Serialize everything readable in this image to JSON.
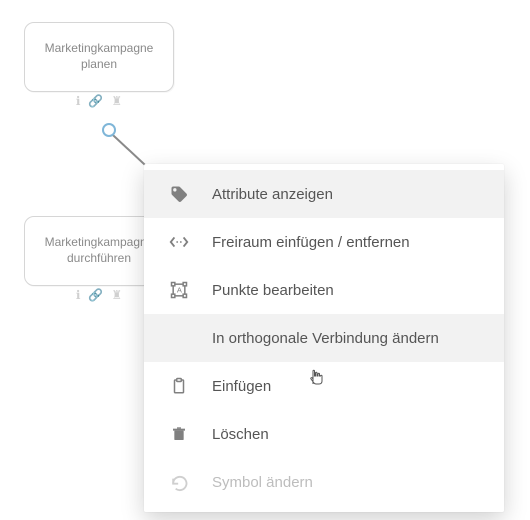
{
  "nodes": {
    "plan": {
      "label": "Marketingkampagne planen"
    },
    "exec": {
      "label": "Marketingkampagne durchführen"
    }
  },
  "menu": {
    "items": [
      {
        "id": "show-attributes",
        "label": "Attribute anzeigen",
        "icon": "tag",
        "disabled": false,
        "hover": true
      },
      {
        "id": "insert-remove-space",
        "label": "Freiraum einfügen / entfernen",
        "icon": "spacer",
        "disabled": false,
        "hover": false
      },
      {
        "id": "edit-points",
        "label": "Punkte bearbeiten",
        "icon": "transform",
        "disabled": false,
        "hover": false
      },
      {
        "id": "to-orthogonal",
        "label": "In orthogonale Verbindung ändern",
        "icon": "",
        "disabled": false,
        "hover": true
      },
      {
        "id": "paste",
        "label": "Einfügen",
        "icon": "clipboard",
        "disabled": false,
        "hover": false
      },
      {
        "id": "delete",
        "label": "Löschen",
        "icon": "trash",
        "disabled": false,
        "hover": false
      },
      {
        "id": "change-symbol",
        "label": "Symbol ändern",
        "icon": "undo",
        "disabled": true,
        "hover": false
      }
    ]
  }
}
